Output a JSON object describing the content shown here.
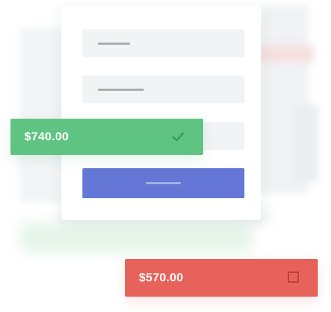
{
  "card": {
    "fields": [
      {
        "placeholder": ""
      },
      {
        "placeholder": ""
      },
      {
        "placeholder": ""
      }
    ],
    "submit_label": ""
  },
  "toasts": {
    "success": {
      "amount": "$740.00",
      "icon": "check-icon",
      "color": "#5fc481"
    },
    "error": {
      "amount": "$570.00",
      "icon": "square-icon",
      "color": "#e8625c"
    }
  },
  "colors": {
    "submit": "#6477d6",
    "field_background": "#f2f3f5"
  }
}
